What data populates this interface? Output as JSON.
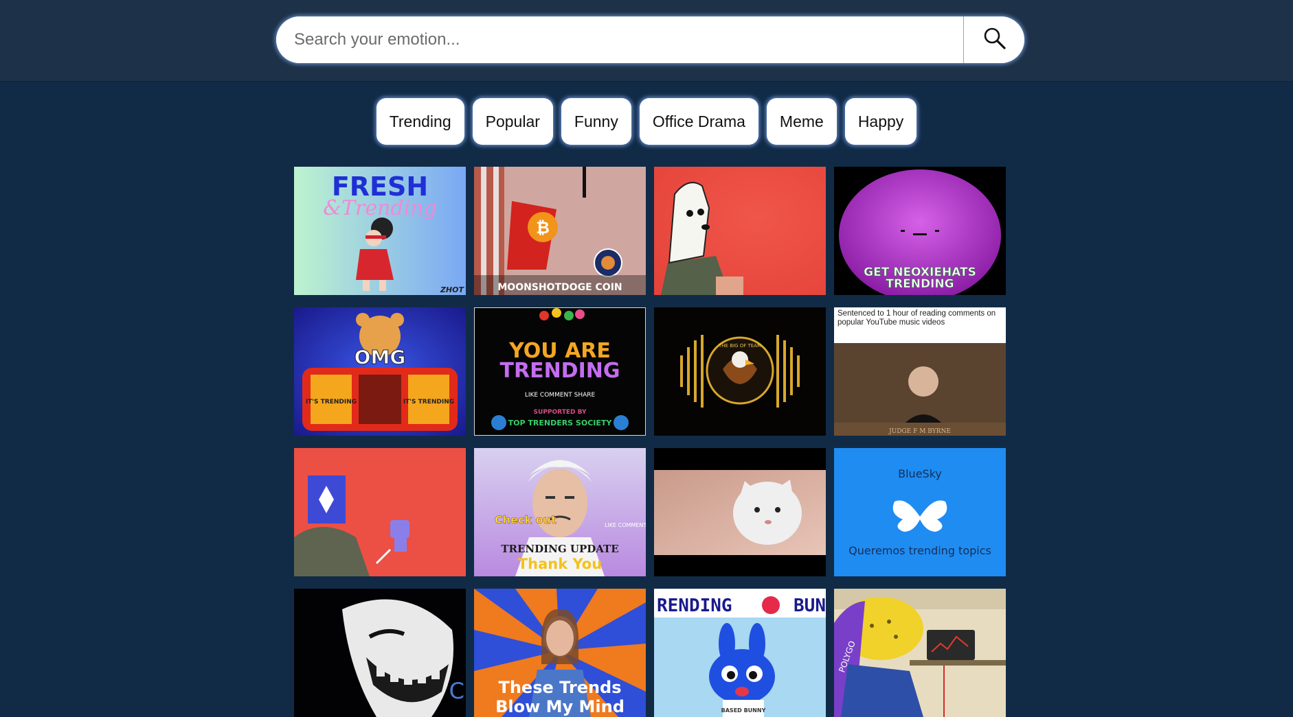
{
  "search": {
    "placeholder": "Search your emotion..."
  },
  "icons": {
    "search_button": "search-icon"
  },
  "colors": {
    "page_background": "#112b47",
    "header_background": "#1d3248",
    "glow": "#78a0e6"
  },
  "tags": [
    {
      "label": "Trending"
    },
    {
      "label": "Popular"
    },
    {
      "label": "Funny"
    },
    {
      "label": "Office Drama"
    },
    {
      "label": "Meme"
    },
    {
      "label": "Happy"
    }
  ],
  "gifs": [
    {
      "caption_1": "FRESH",
      "caption_2": "&Trending",
      "watermark": "ZHOT"
    },
    {
      "caption_1": "MOONSHOTDOGE COIN"
    },
    {},
    {
      "caption_1": "GET NEOXIEHATS",
      "caption_2": "TRENDING"
    },
    {
      "caption_1": "OMG",
      "caption_2": "IT'S TRENDING",
      "caption_3": "IT'S TRENDING"
    },
    {
      "caption_1": "YOU ARE",
      "caption_2": "TRENDING",
      "caption_3": "LIKE COMMENT SHARE",
      "caption_4": "SUPPORTED BY",
      "caption_5": "TOP TRENDERS SOCIETY"
    },
    {
      "caption_1": "THE BIG OF TEAM"
    },
    {
      "caption_1": "Sentenced to 1 hour of reading comments on popular YouTube music videos",
      "caption_2": "JUDGE F M BYRNE"
    },
    {},
    {
      "caption_1": "Check out",
      "caption_2": "TRENDING UPDATE",
      "caption_3": "Thank You",
      "caption_4": "LIKE COMMENT"
    },
    {},
    {
      "caption_1": "BlueSky",
      "caption_2": "Queremos trending topics"
    },
    {
      "caption_1": "C"
    },
    {
      "caption_1": "These Trends",
      "caption_2": "Blow My Mind"
    },
    {
      "caption_1": "RENDING",
      "caption_2": "BUN",
      "caption_3": "BASED BUNNY"
    },
    {
      "caption_1": "POLYGO"
    }
  ]
}
